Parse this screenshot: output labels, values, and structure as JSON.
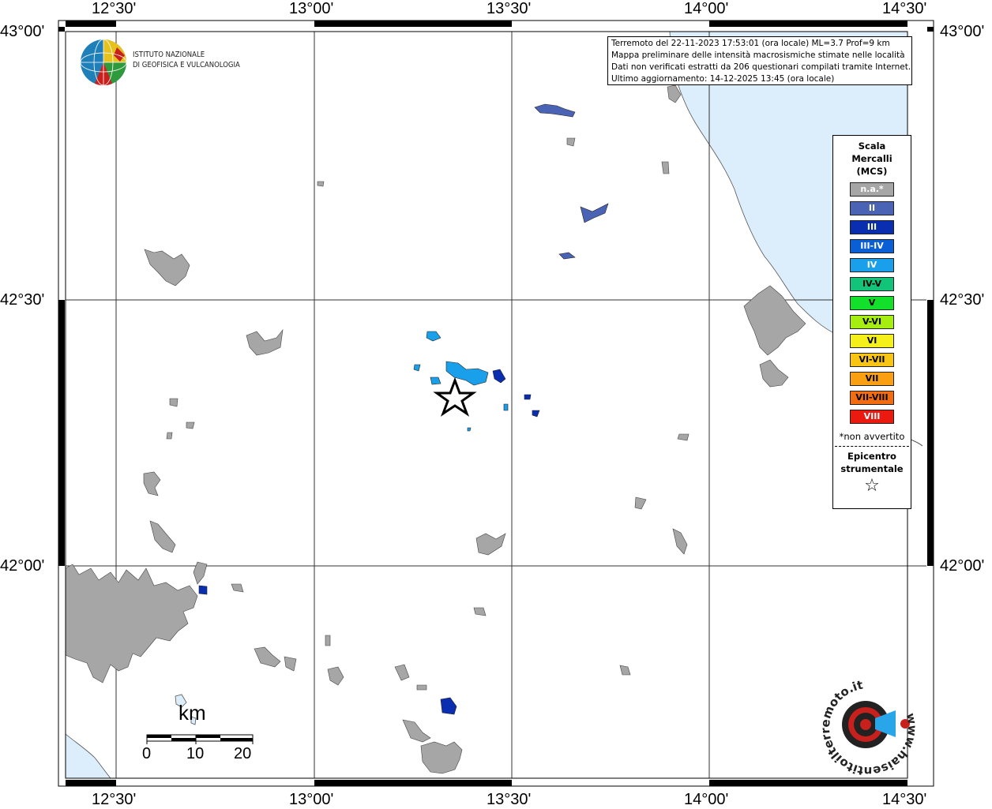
{
  "map": {
    "lon_ticks": [
      "12°30'",
      "13°00'",
      "13°30'",
      "14°00'",
      "14°30'"
    ],
    "lat_ticks": [
      "43°00'",
      "42°30'",
      "42°00'"
    ]
  },
  "info_box": {
    "line1": "Terremoto del 22-11-2023 17:53:01 (ora locale) ML=3.7 Prof=9 km",
    "line2": "Mappa preliminare delle intensità macrosismiche stimate nelle località",
    "line3": "Dati non verificati estratti da 206 questionari compilati tramite Internet.",
    "line4": "Ultimo aggiornamento: 14-12-2025 13:45 (ora locale)"
  },
  "logo": {
    "line1": "ISTITUTO NAZIONALE",
    "line2": "DI GEOFISICA E VULCANOLOGIA"
  },
  "legend": {
    "title1": "Scala",
    "title2": "Mercalli",
    "title3": "(MCS)",
    "classes": [
      {
        "label": "n.a.*",
        "color": "#a6a6a6",
        "text": "#ffffff"
      },
      {
        "label": "II",
        "color": "#4a63b4",
        "text": "#ffffff"
      },
      {
        "label": "III",
        "color": "#0a2eb0",
        "text": "#ffffff"
      },
      {
        "label": "III-IV",
        "color": "#0a5fd6",
        "text": "#ffffff"
      },
      {
        "label": "IV",
        "color": "#1aa0ea",
        "text": "#ffffff"
      },
      {
        "label": "IV-V",
        "color": "#11c47a",
        "text": "#000000"
      },
      {
        "label": "V",
        "color": "#12e02a",
        "text": "#000000"
      },
      {
        "label": "V-VI",
        "color": "#a6ee10",
        "text": "#000000"
      },
      {
        "label": "VI",
        "color": "#f5f01a",
        "text": "#000000"
      },
      {
        "label": "VI-VII",
        "color": "#f8c512",
        "text": "#000000"
      },
      {
        "label": "VII",
        "color": "#f9a012",
        "text": "#000000"
      },
      {
        "label": "VII-VIII",
        "color": "#f36d10",
        "text": "#000000"
      },
      {
        "label": "VIII",
        "color": "#ea1a10",
        "text": "#ffffff"
      }
    ],
    "na_note": "*non avvertito",
    "epi_line1": "Epicentro",
    "epi_line2": "strumentale",
    "epi_symbol": "☆"
  },
  "scale_bar": {
    "unit": "km",
    "labels": [
      "0",
      "10",
      "20"
    ]
  },
  "site_logo": {
    "text": "www.haisentitoilterremoto.it"
  },
  "colors": {
    "sea": "#dceefb",
    "land_na": "#a6a6a6",
    "intensity_ii": "#4a63b4",
    "intensity_iii": "#0a2eb0",
    "intensity_iv": "#1aa0ea"
  }
}
